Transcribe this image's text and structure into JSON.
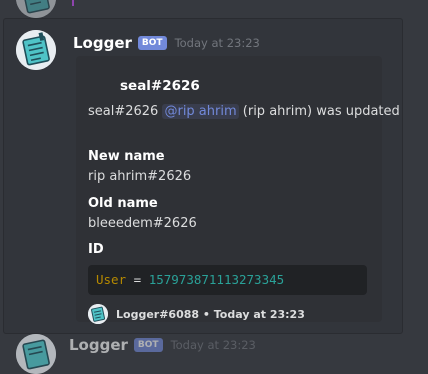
{
  "message": {
    "username": "Logger",
    "bot_tag": "BOT",
    "timestamp": "Today at 23:23"
  },
  "embed": {
    "title": "seal#2626",
    "description_prefix": "seal#2626",
    "mention": "@rip ahrim",
    "description_suffix": "(rip ahrim) was updated",
    "fields": [
      {
        "name": "New name",
        "value": "rip ahrim#2626"
      },
      {
        "name": "Old name",
        "value": "bleeedem#2626"
      },
      {
        "name": "ID",
        "value": ""
      }
    ],
    "code": {
      "key": "User",
      "equals": "=",
      "value": "157973871113273345"
    },
    "footer": {
      "author": "Logger#6088",
      "separator": "•",
      "time": "Today at 23:23"
    }
  },
  "next_message": {
    "username": "Logger",
    "bot_tag": "BOT",
    "timestamp": "Today at 23:23"
  },
  "colors": {
    "background": "#36393f",
    "embed_bg": "#2f3136",
    "bot_tag": "#7289da",
    "mention": "#7289da",
    "code_key": "#b58900",
    "code_value": "#2aa198"
  }
}
